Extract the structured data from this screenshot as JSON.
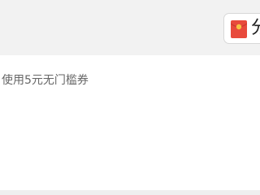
{
  "header": {
    "coupon_button": {
      "icon": "red-packet-icon",
      "label": "分",
      "accent_color": "#e84a3c"
    }
  },
  "main": {
    "coupon_text": "使用5元无门槛券"
  }
}
